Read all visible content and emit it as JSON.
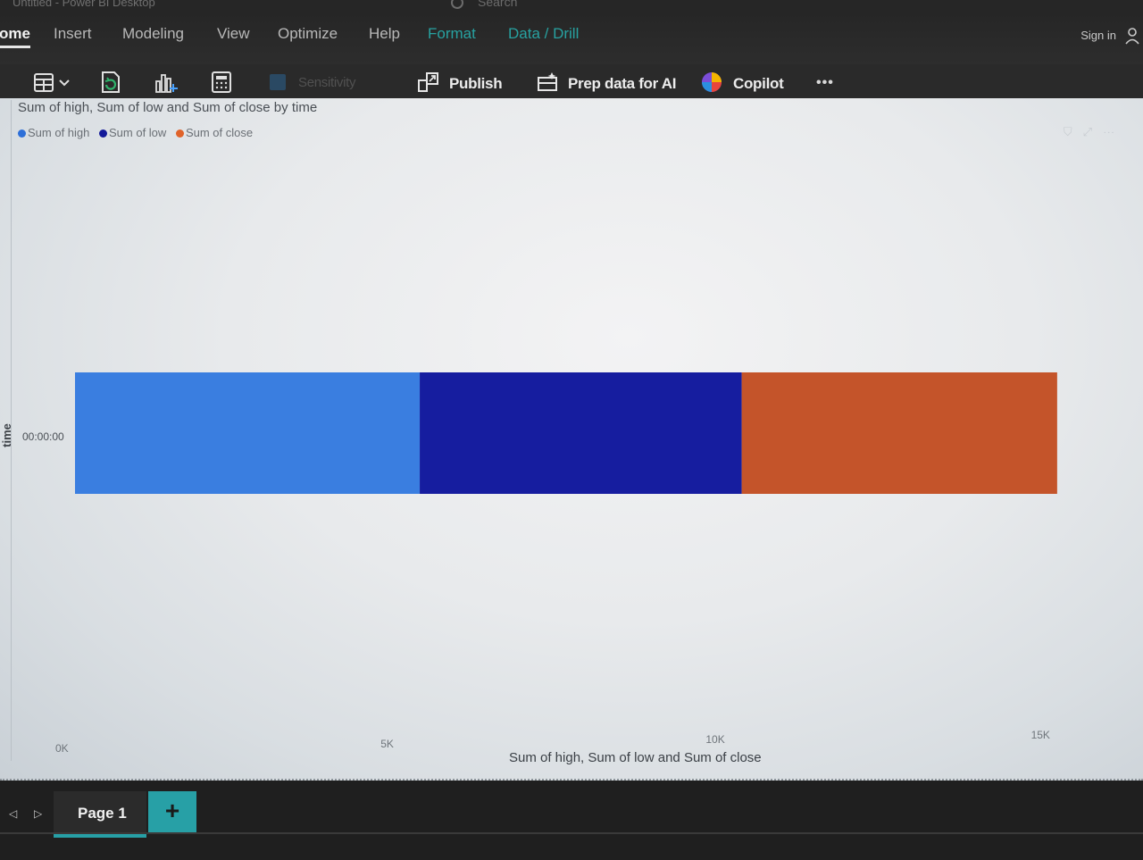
{
  "window": {
    "title": "Untitled - Power BI Desktop",
    "search_placeholder": "Search",
    "sign_in": "Sign in"
  },
  "menu": {
    "items": [
      {
        "label": "ome",
        "active": true
      },
      {
        "label": "Insert"
      },
      {
        "label": "Modeling"
      },
      {
        "label": "View"
      },
      {
        "label": "Optimize"
      },
      {
        "label": "Help"
      },
      {
        "label": "Format",
        "contextual": true
      },
      {
        "label": "Data / Drill",
        "contextual": true
      }
    ]
  },
  "ribbon": {
    "sensitivity": "Sensitivity",
    "publish": "Publish",
    "prep_data": "Prep data for AI",
    "copilot": "Copilot",
    "more": "•••"
  },
  "visual": {
    "title": "Sum of high, Sum of low and Sum of close by time",
    "legend": [
      {
        "name": "Sum of high",
        "color": "#2d6fd8"
      },
      {
        "name": "Sum of low",
        "color": "#131a9a"
      },
      {
        "name": "Sum of close",
        "color": "#e0632a"
      }
    ]
  },
  "chart_data": {
    "type": "bar",
    "orientation": "horizontal",
    "stacked": true,
    "title": "Sum of high, Sum of low and Sum of close by time",
    "categories": [
      "00:00:00"
    ],
    "series": [
      {
        "name": "Sum of high",
        "values": [
          5300
        ],
        "color": "#3a7ee0"
      },
      {
        "name": "Sum of low",
        "values": [
          4950
        ],
        "color": "#161d9f"
      },
      {
        "name": "Sum of close",
        "values": [
          4850
        ],
        "color": "#c4542a"
      }
    ],
    "x_ticks": [
      "0K",
      "5K",
      "10K",
      "15K"
    ],
    "xlim": [
      0,
      15500
    ],
    "xlabel": "Sum of high, Sum of low and Sum of close",
    "ylabel": "time",
    "legend_position": "top-left"
  },
  "pages": {
    "tabs": [
      {
        "label": "Page 1",
        "active": true
      }
    ],
    "add_label": "+"
  }
}
